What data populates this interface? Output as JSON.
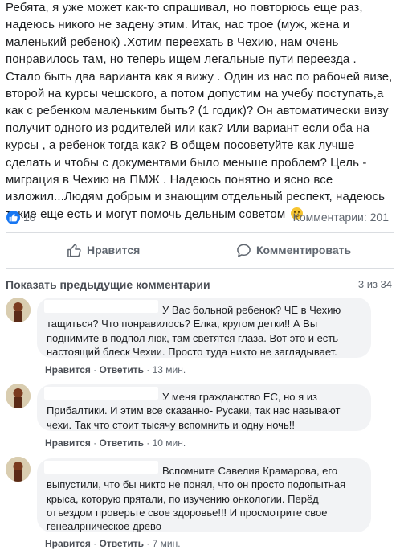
{
  "post": {
    "text": "Ребята, я уже может как-то спрашивал, но повторюсь еще раз, надеюсь никого не задену этим. Итак, нас трое (муж, жена и маленький ребенок) .Хотим переехать в Чехию, нам очень понравилось там, но теперь ищем легальные пути переезда . Стало быть два варианта как я вижу . Один из нас по рабочей визе, второй на курсы чешского, а потом допустим на учебу поступать,а как с ребенком маленьким быть? (1 годик)? Он автоматически визу получит одного из родителей или как? Или вариант если оба на курсы , а ребенок тогда как? В общем посоветуйте как лучше сделать и чтобы с документами было меньше проблем? Цель - миграция в Чехию на ПМЖ . Надеюсь понятно и ясно все изложил...Людям добрым и знающим отдельный респект, надеюсь такие еще есть и могут помочь дельным советом",
    "emoji": "smiley-emoji",
    "likes": "10",
    "comments_count": "Комментарии: 201"
  },
  "actions": {
    "like_label": "Нравится",
    "comment_label": "Комментировать"
  },
  "comments_section": {
    "prev_link": "Показать предыдущие комментарии",
    "page_count": "3 из 34",
    "items": [
      {
        "text": "У Вас больной ребенок? ЧЕ в Чехию тащиться? Что понравилось? Елка, кругом детки!! А Вы поднимите в подпол люк, там светятся глаза. Вот это и есть настоящий блеск Чехии. Просто туда никто не заглядывает.",
        "like": "Нравится",
        "reply": "Ответить",
        "time": "13 мин."
      },
      {
        "text": "У меня гражданство ЕС, но я из Прибалтики. И этим все сказанно- Русаки, так нас называют чехи. Так что стоит тысячу вспомнить и одну ночь!!",
        "like": "Нравится",
        "reply": "Ответить",
        "time": "10 мин."
      },
      {
        "text": "Вспомните Савелия Крамарова, его выпустили, что бы никто не понял, что он просто подопытная крыса, которую прятали, по изучению онкологии. Перёд отъездом проверьте свое здоровье!!! И просмотрите свое генеалрническое древо",
        "like": "Нравится",
        "reply": "Ответить",
        "time": "7 мин."
      }
    ]
  },
  "colors": {
    "brand": "#1877f2",
    "muted": "#606770",
    "bubble": "#f2f3f5"
  }
}
